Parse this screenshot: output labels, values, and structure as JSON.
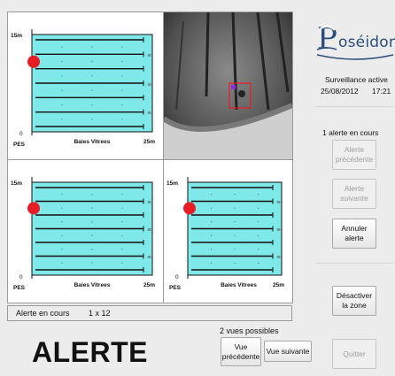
{
  "pools": [
    {
      "y_top_label": "15m",
      "y_zero_label": "0",
      "x_end_label": "25m",
      "x_start_label": "PES",
      "x_mid_label": "Baies Vitrees"
    },
    {
      "y_top_label": "15m",
      "y_zero_label": "0",
      "x_end_label": "25m",
      "x_start_label": "PES",
      "x_mid_label": "Baies Vitrees"
    },
    {
      "y_top_label": "15m",
      "y_zero_label": "0",
      "x_end_label": "25m",
      "x_start_label": "PES",
      "x_mid_label": "Baies Vitrees"
    }
  ],
  "status": {
    "label": "Alerte en cours",
    "value": "1 x 12"
  },
  "big_alert": "ALERTE",
  "views": {
    "label": "2 vues possibles",
    "prev_label": "Vue\nprécédente",
    "next_label": "Vue suivante"
  },
  "sidebar": {
    "logo_text": "oséidon",
    "surveillance": "Surveillance active",
    "date": "25/08/2012",
    "time": "17:21",
    "alert_count": "1 alerte en cours",
    "btn_prev_alert": "Alerte\nprécédente",
    "btn_next_alert": "Alerte\nsuivante",
    "btn_cancel_alert": "Annuler\nalerte",
    "btn_disable_zone": "Désactiver\nla zone",
    "btn_quit": "Quitter"
  },
  "colors": {
    "pool_water": "#7fe8e8",
    "alert_dot": "#e81d24",
    "logo_blue": "#2a4d7c"
  }
}
